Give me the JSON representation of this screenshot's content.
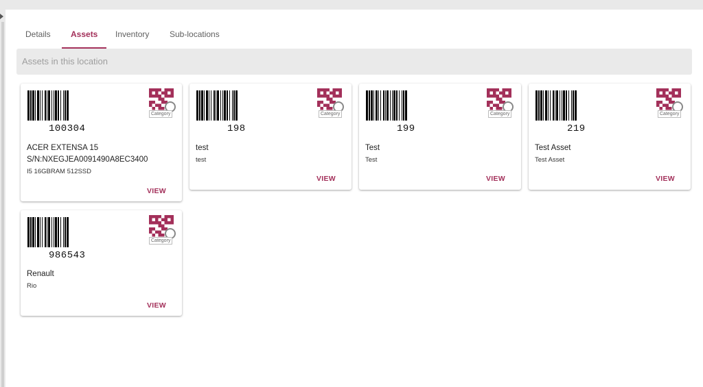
{
  "tabs": [
    {
      "label": "Details"
    },
    {
      "label": "Assets"
    },
    {
      "label": "Inventory"
    },
    {
      "label": "Sub-locations"
    }
  ],
  "active_tab": "Assets",
  "section_title": "Assets in this location",
  "accent_color": "#a3305a",
  "view_label": "VIEW",
  "category_label": "Category",
  "assets": [
    {
      "code": "100304",
      "name": "ACER EXTENSA 15",
      "line2": "S/N:NXEGJEA0091490A8EC3400",
      "line3": "I5 16GBRAM 512SSD"
    },
    {
      "code": "198",
      "name": "test",
      "line2": "test"
    },
    {
      "code": "199",
      "name": "Test",
      "line2": "Test"
    },
    {
      "code": "219",
      "name": "Test Asset",
      "line2": "Test Asset"
    },
    {
      "code": "986543",
      "name": "Renault",
      "line2": "Rio"
    }
  ]
}
